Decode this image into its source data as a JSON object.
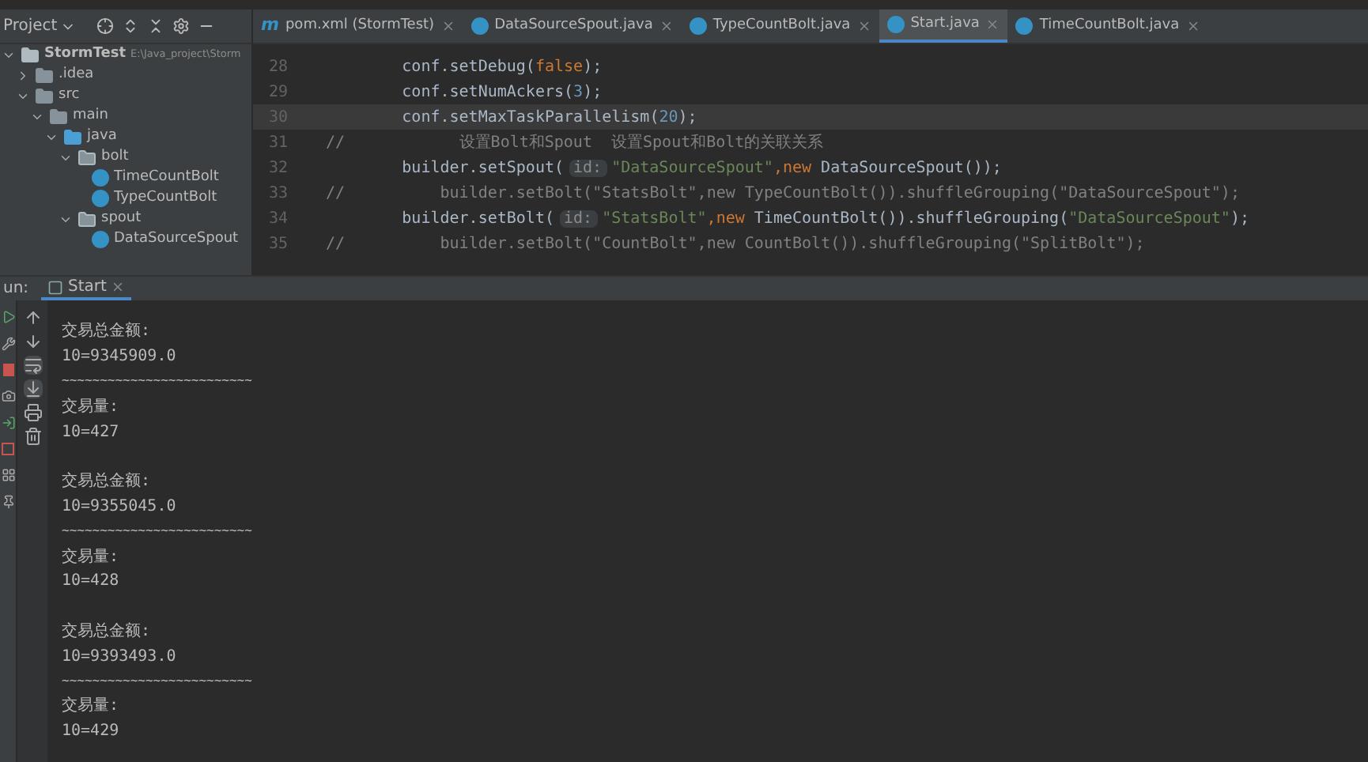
{
  "project_panel": {
    "title": "Project",
    "tree": [
      {
        "label": "StormTest",
        "path": "E:\\Java_project\\Storm",
        "kind": "module",
        "expanded": true,
        "children": [
          {
            "label": ".idea",
            "kind": "folder",
            "expanded": false
          },
          {
            "label": "src",
            "kind": "folder",
            "expanded": true,
            "children": [
              {
                "label": "main",
                "kind": "folder",
                "expanded": true,
                "children": [
                  {
                    "label": "java",
                    "kind": "source",
                    "expanded": true,
                    "children": [
                      {
                        "label": "bolt",
                        "kind": "package",
                        "expanded": true,
                        "children": [
                          {
                            "label": "TimeCountBolt",
                            "kind": "class"
                          },
                          {
                            "label": "TypeCountBolt",
                            "kind": "class"
                          }
                        ]
                      },
                      {
                        "label": "spout",
                        "kind": "package",
                        "expanded": true,
                        "children": [
                          {
                            "label": "DataSourceSpout",
                            "kind": "class"
                          }
                        ]
                      }
                    ]
                  }
                ]
              }
            ]
          }
        ]
      }
    ]
  },
  "editor_tabs": [
    {
      "label": "pom.xml (StormTest)",
      "kind": "maven",
      "icon_text": "m",
      "selected": false
    },
    {
      "label": "DataSourceSpout.java",
      "kind": "class",
      "selected": false
    },
    {
      "label": "TypeCountBolt.java",
      "kind": "class",
      "selected": false
    },
    {
      "label": "Start.java",
      "kind": "class",
      "selected": true
    },
    {
      "label": "TimeCountBolt.java",
      "kind": "class",
      "selected": false
    }
  ],
  "code_lines": [
    {
      "number": "28",
      "selected": false,
      "segments": [
        {
          "text": "        conf.setDebug(",
          "kind": "plain"
        },
        {
          "text": "false",
          "kind": "keyword"
        },
        {
          "text": ");",
          "kind": "plain"
        }
      ]
    },
    {
      "number": "29",
      "selected": false,
      "segments": [
        {
          "text": "        conf.setNumAckers(",
          "kind": "plain"
        },
        {
          "text": "3",
          "kind": "number"
        },
        {
          "text": ");",
          "kind": "plain"
        }
      ]
    },
    {
      "number": "30",
      "selected": true,
      "segments": [
        {
          "text": "        conf.setMaxTaskParallelism(",
          "kind": "plain"
        },
        {
          "text": "20",
          "kind": "number"
        },
        {
          "text": ");",
          "kind": "plain"
        }
      ]
    },
    {
      "number": "31",
      "selected": false,
      "segments": [
        {
          "text": "//",
          "kind": "comment"
        },
        {
          "text": "            设置Bolt和Spout  设置Spout和Bolt的关联关系",
          "kind": "comment"
        }
      ]
    },
    {
      "number": "32",
      "selected": false,
      "segments": [
        {
          "text": "        builder.setSpout(",
          "kind": "plain"
        },
        {
          "text": "id:",
          "kind": "hint"
        },
        {
          "text": "\"DataSourceSpout\"",
          "kind": "string"
        },
        {
          "text": ",",
          "kind": "keyword"
        },
        {
          "text": "new",
          "kind": "keyword"
        },
        {
          "text": " DataSourceSpout());",
          "kind": "plain"
        }
      ]
    },
    {
      "number": "33",
      "selected": false,
      "segments": [
        {
          "text": "//",
          "kind": "comment"
        },
        {
          "text": "          builder.setBolt(\"StatsBolt\",new TypeCountBolt()).shuffleGrouping(\"DataSourceSpout\");",
          "kind": "comment"
        }
      ]
    },
    {
      "number": "34",
      "selected": false,
      "segments": [
        {
          "text": "        builder.setBolt(",
          "kind": "plain"
        },
        {
          "text": "id:",
          "kind": "hint"
        },
        {
          "text": "\"StatsBolt\"",
          "kind": "string"
        },
        {
          "text": ",",
          "kind": "keyword"
        },
        {
          "text": "new",
          "kind": "keyword"
        },
        {
          "text": " TimeCountBolt()).shuffleGrouping(",
          "kind": "plain"
        },
        {
          "text": "\"DataSourceSpout\"",
          "kind": "string"
        },
        {
          "text": ");",
          "kind": "plain"
        }
      ]
    },
    {
      "number": "35",
      "selected": false,
      "segments": [
        {
          "text": "//",
          "kind": "comment"
        },
        {
          "text": "          builder.setBolt(\"CountBolt\",new CountBolt()).shuffleGrouping(\"SplitBolt\");",
          "kind": "comment"
        }
      ]
    }
  ],
  "run_panel": {
    "label": "un:",
    "tab": "Start",
    "output": [
      [
        "交易总金额:",
        "10=9345909.0",
        "~~~~~~~~~~~~~~~~~~~~~~~~~",
        "交易量:",
        "10=427"
      ],
      [
        "交易总金额:",
        "10=9355045.0",
        "~~~~~~~~~~~~~~~~~~~~~~~~~",
        "交易量:",
        "10=428"
      ],
      [
        "交易总金额:",
        "10=9393493.0",
        "~~~~~~~~~~~~~~~~~~~~~~~~~",
        "交易量:",
        "10=429"
      ]
    ]
  }
}
